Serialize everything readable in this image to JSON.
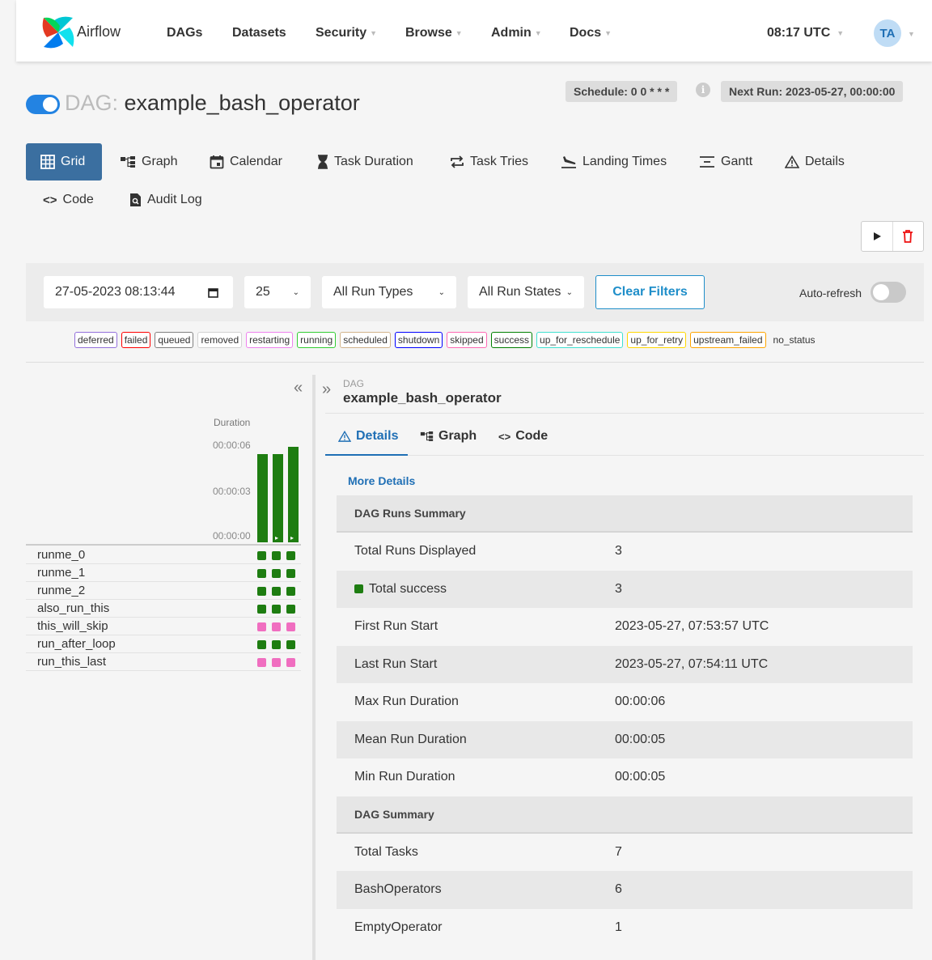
{
  "navbar": {
    "brand": "Airflow",
    "items": [
      {
        "label": "DAGs",
        "dropdown": false
      },
      {
        "label": "Datasets",
        "dropdown": false
      },
      {
        "label": "Security",
        "dropdown": true
      },
      {
        "label": "Browse",
        "dropdown": true
      },
      {
        "label": "Admin",
        "dropdown": true
      },
      {
        "label": "Docs",
        "dropdown": true
      }
    ],
    "clock": "08:17 UTC",
    "avatar": "TA"
  },
  "header": {
    "prefix": "DAG:",
    "dag_id": "example_bash_operator",
    "schedule": "Schedule: 0 0 * * *",
    "next_run": "Next Run: 2023-05-27, 00:00:00"
  },
  "tabs": [
    {
      "label": "Grid",
      "icon": "grid-icon",
      "active": true
    },
    {
      "label": "Graph",
      "icon": "graph-icon",
      "active": false
    },
    {
      "label": "Calendar",
      "icon": "calendar-icon",
      "active": false
    },
    {
      "label": "Task Duration",
      "icon": "hourglass-icon",
      "active": false
    },
    {
      "label": "Task Tries",
      "icon": "repeat-icon",
      "active": false
    },
    {
      "label": "Landing Times",
      "icon": "plane-landing-icon",
      "active": false
    },
    {
      "label": "Gantt",
      "icon": "gantt-icon",
      "active": false
    },
    {
      "label": "Details",
      "icon": "warning-triangle-icon",
      "active": false
    },
    {
      "label": "Code",
      "icon": "code-icon",
      "active": false
    },
    {
      "label": "Audit Log",
      "icon": "audit-log-icon",
      "active": false
    }
  ],
  "filters": {
    "date": "27-05-2023 08:13:44",
    "limit": "25",
    "run_types": "All Run Types",
    "run_states": "All Run States",
    "clear": "Clear Filters",
    "auto_refresh": "Auto-refresh"
  },
  "legend": [
    {
      "label": "deferred",
      "color": "#9370db"
    },
    {
      "label": "failed",
      "color": "#ff0000"
    },
    {
      "label": "queued",
      "color": "#808080"
    },
    {
      "label": "removed",
      "color": "#d3d3d3"
    },
    {
      "label": "restarting",
      "color": "#ee82ee"
    },
    {
      "label": "running",
      "color": "#32cd32"
    },
    {
      "label": "scheduled",
      "color": "#d2b48c"
    },
    {
      "label": "shutdown",
      "color": "#0000ff"
    },
    {
      "label": "skipped",
      "color": "#ff69b4"
    },
    {
      "label": "success",
      "color": "#008000"
    },
    {
      "label": "up_for_reschedule",
      "color": "#40e0d0"
    },
    {
      "label": "up_for_retry",
      "color": "#ffd700"
    },
    {
      "label": "upstream_failed",
      "color": "#ffa500"
    },
    {
      "label": "no_status",
      "color": ""
    }
  ],
  "grid": {
    "duration_label": "Duration",
    "ticks": [
      "00:00:06",
      "00:00:03",
      "00:00:00"
    ],
    "run_durations_sec": [
      6,
      6,
      6.5
    ],
    "tasks": [
      {
        "name": "runme_0",
        "states": [
          "success",
          "success",
          "success"
        ]
      },
      {
        "name": "runme_1",
        "states": [
          "success",
          "success",
          "success"
        ]
      },
      {
        "name": "runme_2",
        "states": [
          "success",
          "success",
          "success"
        ]
      },
      {
        "name": "also_run_this",
        "states": [
          "success",
          "success",
          "success"
        ]
      },
      {
        "name": "this_will_skip",
        "states": [
          "skipped",
          "skipped",
          "skipped"
        ]
      },
      {
        "name": "run_after_loop",
        "states": [
          "success",
          "success",
          "success"
        ]
      },
      {
        "name": "run_this_last",
        "states": [
          "skipped",
          "skipped",
          "skipped"
        ]
      }
    ],
    "state_colors": {
      "success": "#1e7d11",
      "skipped": "#f06ec0"
    }
  },
  "details": {
    "kicker": "DAG",
    "dag_id": "example_bash_operator",
    "tabs": [
      {
        "label": "Details",
        "icon": "warning-triangle-icon",
        "active": true
      },
      {
        "label": "Graph",
        "icon": "graph-icon",
        "active": false
      },
      {
        "label": "Code",
        "icon": "code-icon",
        "active": false
      }
    ],
    "more_details": "More Details",
    "rows": [
      {
        "kind": "head",
        "label": "DAG Runs Summary"
      },
      {
        "kind": "row",
        "label": "Total Runs Displayed",
        "value": "3"
      },
      {
        "kind": "row",
        "label": "Total success",
        "value": "3",
        "dot": true
      },
      {
        "kind": "row",
        "label": "First Run Start",
        "value": "2023-05-27, 07:53:57 UTC"
      },
      {
        "kind": "row",
        "label": "Last Run Start",
        "value": "2023-05-27, 07:54:11 UTC"
      },
      {
        "kind": "row",
        "label": "Max Run Duration",
        "value": "00:00:06"
      },
      {
        "kind": "row",
        "label": "Mean Run Duration",
        "value": "00:00:05"
      },
      {
        "kind": "row",
        "label": "Min Run Duration",
        "value": "00:00:05"
      },
      {
        "kind": "head",
        "label": "DAG Summary"
      },
      {
        "kind": "row",
        "label": "Total Tasks",
        "value": "7"
      },
      {
        "kind": "row",
        "label": "BashOperators",
        "value": "6"
      },
      {
        "kind": "row",
        "label": "EmptyOperator",
        "value": "1"
      }
    ]
  }
}
